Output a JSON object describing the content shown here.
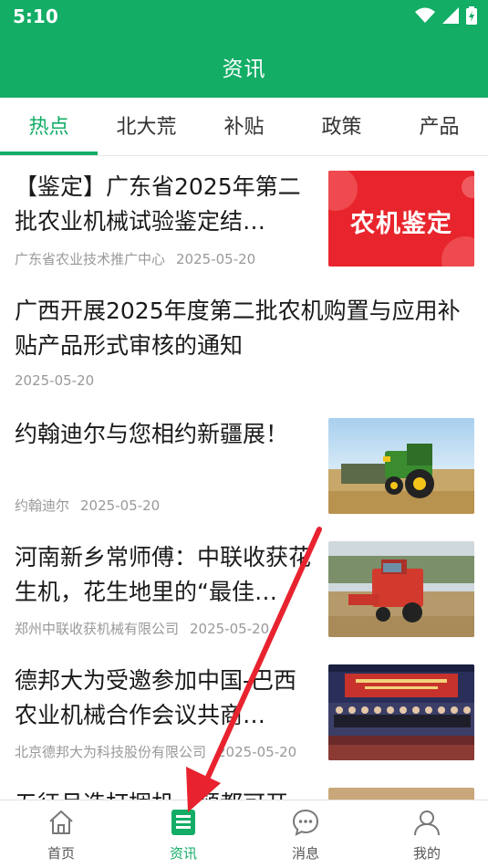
{
  "status": {
    "time": "5:10"
  },
  "header": {
    "title": "资讯"
  },
  "tabs": [
    {
      "label": "热点"
    },
    {
      "label": "北大荒"
    },
    {
      "label": "补贴"
    },
    {
      "label": "政策"
    },
    {
      "label": "产品"
    }
  ],
  "news": [
    {
      "title": "【鉴定】广东省2025年第二批农业机械试验鉴定结…",
      "source": "广东省农业技术推广中心",
      "date": "2025-05-20",
      "thumb_text": "农机鉴定"
    },
    {
      "title": "广西开展2025年度第二批农机购置与应用补贴产品形式审核的通知",
      "source": "",
      "date": "2025-05-20"
    },
    {
      "title": "约翰迪尔与您相约新疆展！",
      "source": "约翰迪尔",
      "date": "2025-05-20"
    },
    {
      "title": "河南新乡常师傅：中联收获花生机，花生地里的“最佳…",
      "source": "郑州中联收获机械有限公司",
      "date": "2025-05-20"
    },
    {
      "title": "德邦大为受邀参加中国-巴西农业机械合作会议共商…",
      "source": "北京德邦大为科技股份有限公司",
      "date": "2025-05-20"
    },
    {
      "title": "五征月造打捆机一顿都可开…",
      "source": "",
      "date": ""
    }
  ],
  "bottom_nav": [
    {
      "label": "首页",
      "icon": "home-icon"
    },
    {
      "label": "资讯",
      "icon": "news-icon"
    },
    {
      "label": "消息",
      "icon": "message-icon"
    },
    {
      "label": "我的",
      "icon": "user-icon"
    }
  ],
  "colors": {
    "brand": "#13ad66",
    "arrow": "#e8232f"
  }
}
